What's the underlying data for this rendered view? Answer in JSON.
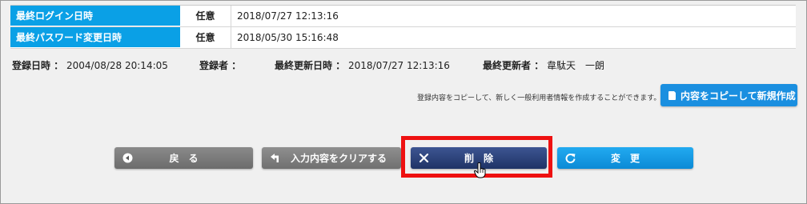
{
  "info_table": {
    "rows": [
      {
        "label": "最終ログイン日時",
        "required": "任意",
        "value": "2018/07/27 12:13:16"
      },
      {
        "label": "最終パスワード変更日時",
        "required": "任意",
        "value": "2018/05/30 15:16:48"
      }
    ]
  },
  "meta": {
    "registered_at_label": "登録日時 ：",
    "registered_at_value": "2004/08/28 20:14:05",
    "registrant_label": "登録者 ：",
    "registrant_value": "",
    "updated_at_label": "最終更新日時 ：",
    "updated_at_value": "2018/07/27 12:13:16",
    "updater_label": "最終更新者 ：",
    "updater_value": "韋駄天　一朗"
  },
  "copy_section": {
    "note": "登録内容をコピーして、新しく一般利用者情報を作成することができます。",
    "button_label": "内容をコピーして新規作成"
  },
  "actions": {
    "back_label": "戻　る",
    "clear_label": "入力内容をクリアする",
    "delete_label": "削　除",
    "update_label": "変　更"
  },
  "colors": {
    "header_blue": "#0aa0e6",
    "delete_navy": "#1f3366",
    "update_blue": "#0b8ad6",
    "highlight_red": "#ee1111"
  }
}
